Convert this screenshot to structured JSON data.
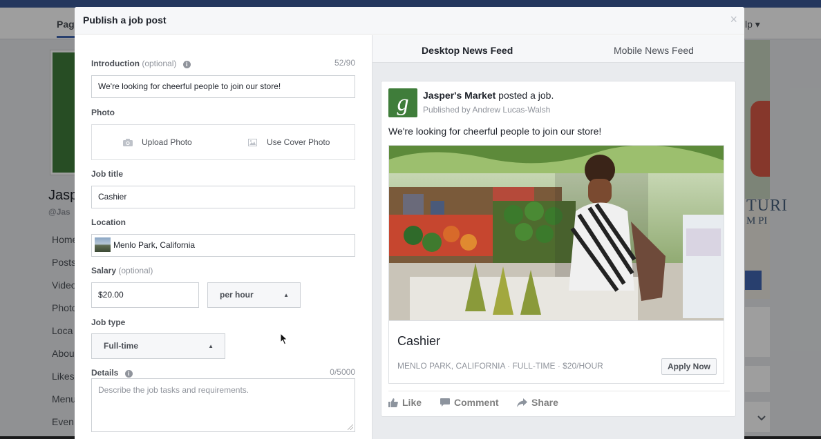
{
  "background": {
    "tabs": {
      "page": "Pag",
      "help": "lp ▾"
    },
    "page_name": "Jasp",
    "page_handle": "@Jas",
    "nav": [
      "Home",
      "Posts",
      "Video",
      "Photo",
      "Loca",
      "Abou",
      "Likes",
      "Menu",
      "Even"
    ],
    "ad_text": [
      "TURI",
      "M PI"
    ]
  },
  "dialog": {
    "title": "Publish a job post",
    "close_glyph": "×"
  },
  "form": {
    "introduction": {
      "label": "Introduction",
      "optional": "(optional)",
      "counter": "52/90",
      "value": "We're looking for cheerful people to join our store!"
    },
    "photo": {
      "label": "Photo",
      "upload": "Upload Photo",
      "cover": "Use Cover Photo"
    },
    "job_title": {
      "label": "Job title",
      "value": "Cashier"
    },
    "location": {
      "label": "Location",
      "value": "Menlo Park, California"
    },
    "salary": {
      "label": "Salary",
      "optional": "(optional)",
      "value": "$20.00",
      "period": "per hour"
    },
    "job_type": {
      "label": "Job type",
      "value": "Full-time"
    },
    "details": {
      "label": "Details",
      "counter": "0/5000",
      "placeholder": "Describe the job tasks and requirements."
    }
  },
  "preview": {
    "tabs": [
      "Desktop News Feed",
      "Mobile News Feed"
    ],
    "post": {
      "author": "Jasper's Market",
      "action": "posted a job.",
      "published_by": "Published by Andrew Lucas-Walsh",
      "text": "We're looking for cheerful people to join our store!",
      "job_title": "Cashier",
      "meta": "MENLO PARK, CALIFORNIA · FULL-TIME · $20/HOUR",
      "apply_label": "Apply Now",
      "actions": {
        "like": "Like",
        "comment": "Comment",
        "share": "Share"
      }
    }
  },
  "colors": {
    "brand": "#3b5998",
    "accent": "#4267b2",
    "logo_green": "#3f7d3a"
  }
}
